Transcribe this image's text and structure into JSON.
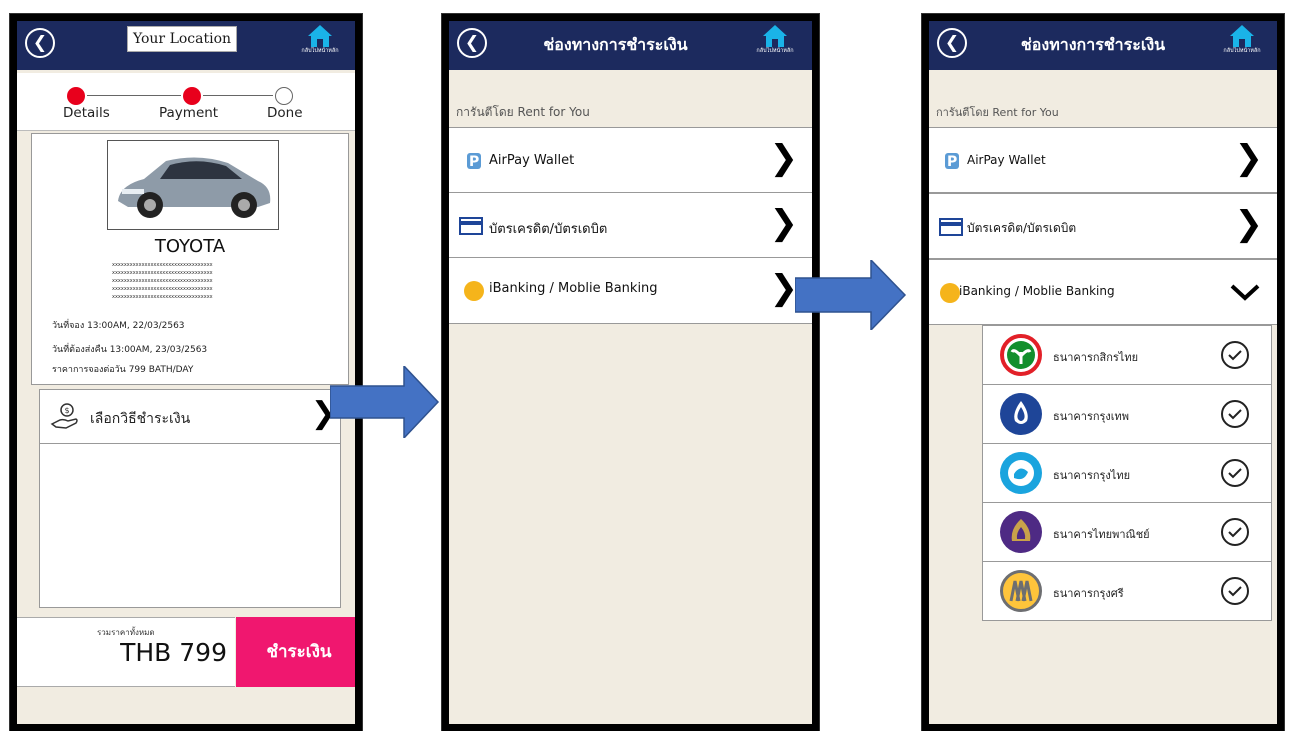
{
  "screen1": {
    "location_label": "Your Location",
    "home_label": "กลับไปหน้าหลัก",
    "steps": [
      "Details",
      "Payment",
      "Done"
    ],
    "car": {
      "brand": "TOYOTA",
      "placeholder_lines": [
        "xxxxxxxxxxxxxxxxxxxxxxxxxxxxxxxxxx",
        "xxxxxxxxxxxxxxxxxxxxxxxxxxxxxxxxxx",
        "xxxxxxxxxxxxxxxxxxxxxxxxxxxxxxxxxx",
        "xxxxxxxxxxxxxxxxxxxxxxxxxxxxxxxxxx",
        "xxxxxxxxxxxxxxxxxxxxxxxxxxxxxxxxxx"
      ],
      "booking_date": "วันที่จอง  13:00AM, 22/03/2563",
      "return_date": "วันที่ต้องส่งคืน  13:00AM, 23/03/2563",
      "price_per_day": "ราคาการจองต่อวัน 799 BATH/DAY"
    },
    "select_payment_label": "เลือกวิธีชำระเงิน",
    "total_label": "รวมราคาทั้งหมด",
    "total_amount": "THB 799",
    "pay_button": "ชำระเงิน"
  },
  "screen2": {
    "title": "ช่องทางการชำระเงิน",
    "home_label": "กลับไปหน้าหลัก",
    "guarantee": "การันตีโดย Rent for You",
    "options": [
      "AirPay Wallet",
      "บัตรเครดิต/บัตรเดบิต",
      "iBanking / Moblie Banking"
    ]
  },
  "screen3": {
    "title": "ช่องทางการชำระเงิน",
    "home_label": "กลับไปหน้าหลัก",
    "guarantee": "การันตีโดย Rent for You",
    "options": [
      "AirPay Wallet",
      "บัตรเครดิต/บัตรเดบิต",
      "iBanking / Moblie Banking"
    ],
    "banks": [
      {
        "name": "ธนาคารกสิกรไทย",
        "color": "#138f2d",
        "ring": "#e22028"
      },
      {
        "name": "ธนาคารกรุงเทพ",
        "color": "#1e4598",
        "ring": "#1e4598"
      },
      {
        "name": "ธนาคารกรุงไทย",
        "color": "#1aa4de",
        "ring": "#1aa4de"
      },
      {
        "name": "ธนาคารไทยพาณิชย์",
        "color": "#4e2a84",
        "ring": "#4e2a84"
      },
      {
        "name": "ธนาคารกรุงศรี",
        "color": "#fec43b",
        "ring": "#6d6e71"
      }
    ]
  },
  "colors": {
    "topbar": "#1c2a5e",
    "pay_button": "#f0176f",
    "step_active": "#e8001c",
    "flow_arrow": "#4472c4"
  }
}
